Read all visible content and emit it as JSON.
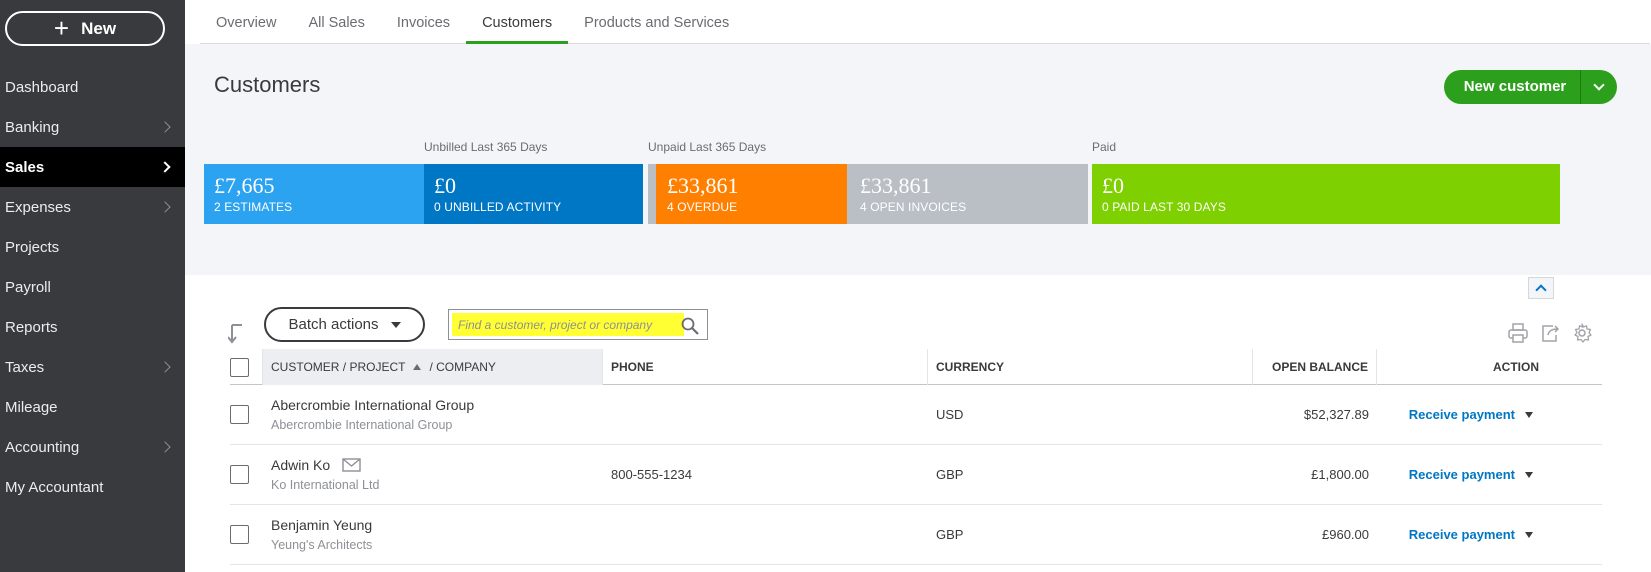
{
  "sidebar": {
    "new_button_label": "New",
    "items": [
      {
        "label": "Dashboard"
      },
      {
        "label": "Banking"
      },
      {
        "label": "Sales"
      },
      {
        "label": "Expenses"
      },
      {
        "label": "Projects"
      },
      {
        "label": "Payroll"
      },
      {
        "label": "Reports"
      },
      {
        "label": "Taxes"
      },
      {
        "label": "Mileage"
      },
      {
        "label": "Accounting"
      },
      {
        "label": "My Accountant"
      }
    ]
  },
  "tabs": [
    {
      "label": "Overview"
    },
    {
      "label": "All Sales"
    },
    {
      "label": "Invoices"
    },
    {
      "label": "Customers"
    },
    {
      "label": "Products and Services"
    }
  ],
  "page_title": "Customers",
  "new_customer_label": "New customer",
  "summary": {
    "unbilled_label": "Unbilled Last 365 Days",
    "unpaid_label": "Unpaid Last 365 Days",
    "paid_label": "Paid",
    "cards": [
      {
        "amount": "£7,665",
        "sub": "2 ESTIMATES",
        "color": "#2ca3f1"
      },
      {
        "amount": "£0",
        "sub": "0 UNBILLED ACTIVITY",
        "color": "#0077c5"
      },
      {
        "amount": "£33,861",
        "sub": "4 OVERDUE",
        "color": "#ff8000"
      },
      {
        "amount": "£33,861",
        "sub": "4 OPEN INVOICES",
        "color": "#babec5"
      },
      {
        "amount": "£0",
        "sub": "0 PAID LAST 30 DAYS",
        "color": "#7fd000"
      }
    ]
  },
  "toolbar": {
    "batch_actions_label": "Batch actions",
    "search_placeholder": "Find a customer, project or company"
  },
  "table": {
    "headers": {
      "customer": "CUSTOMER / PROJECT",
      "company": "/ COMPANY",
      "phone": "PHONE",
      "currency": "CURRENCY",
      "open_balance": "OPEN BALANCE",
      "action": "ACTION"
    },
    "rows": [
      {
        "name": "Abercrombie International Group",
        "company": "Abercrombie International Group",
        "phone": "",
        "currency": "USD",
        "balance": "$52,327.89",
        "action": "Receive payment"
      },
      {
        "name": "Adwin Ko",
        "company": "Ko International Ltd",
        "phone": "800-555-1234",
        "currency": "GBP",
        "balance": "£1,800.00",
        "action": "Receive payment"
      },
      {
        "name": "Benjamin Yeung",
        "company": "Yeung's Architects",
        "phone": "",
        "currency": "GBP",
        "balance": "£960.00",
        "action": "Receive payment"
      }
    ]
  }
}
